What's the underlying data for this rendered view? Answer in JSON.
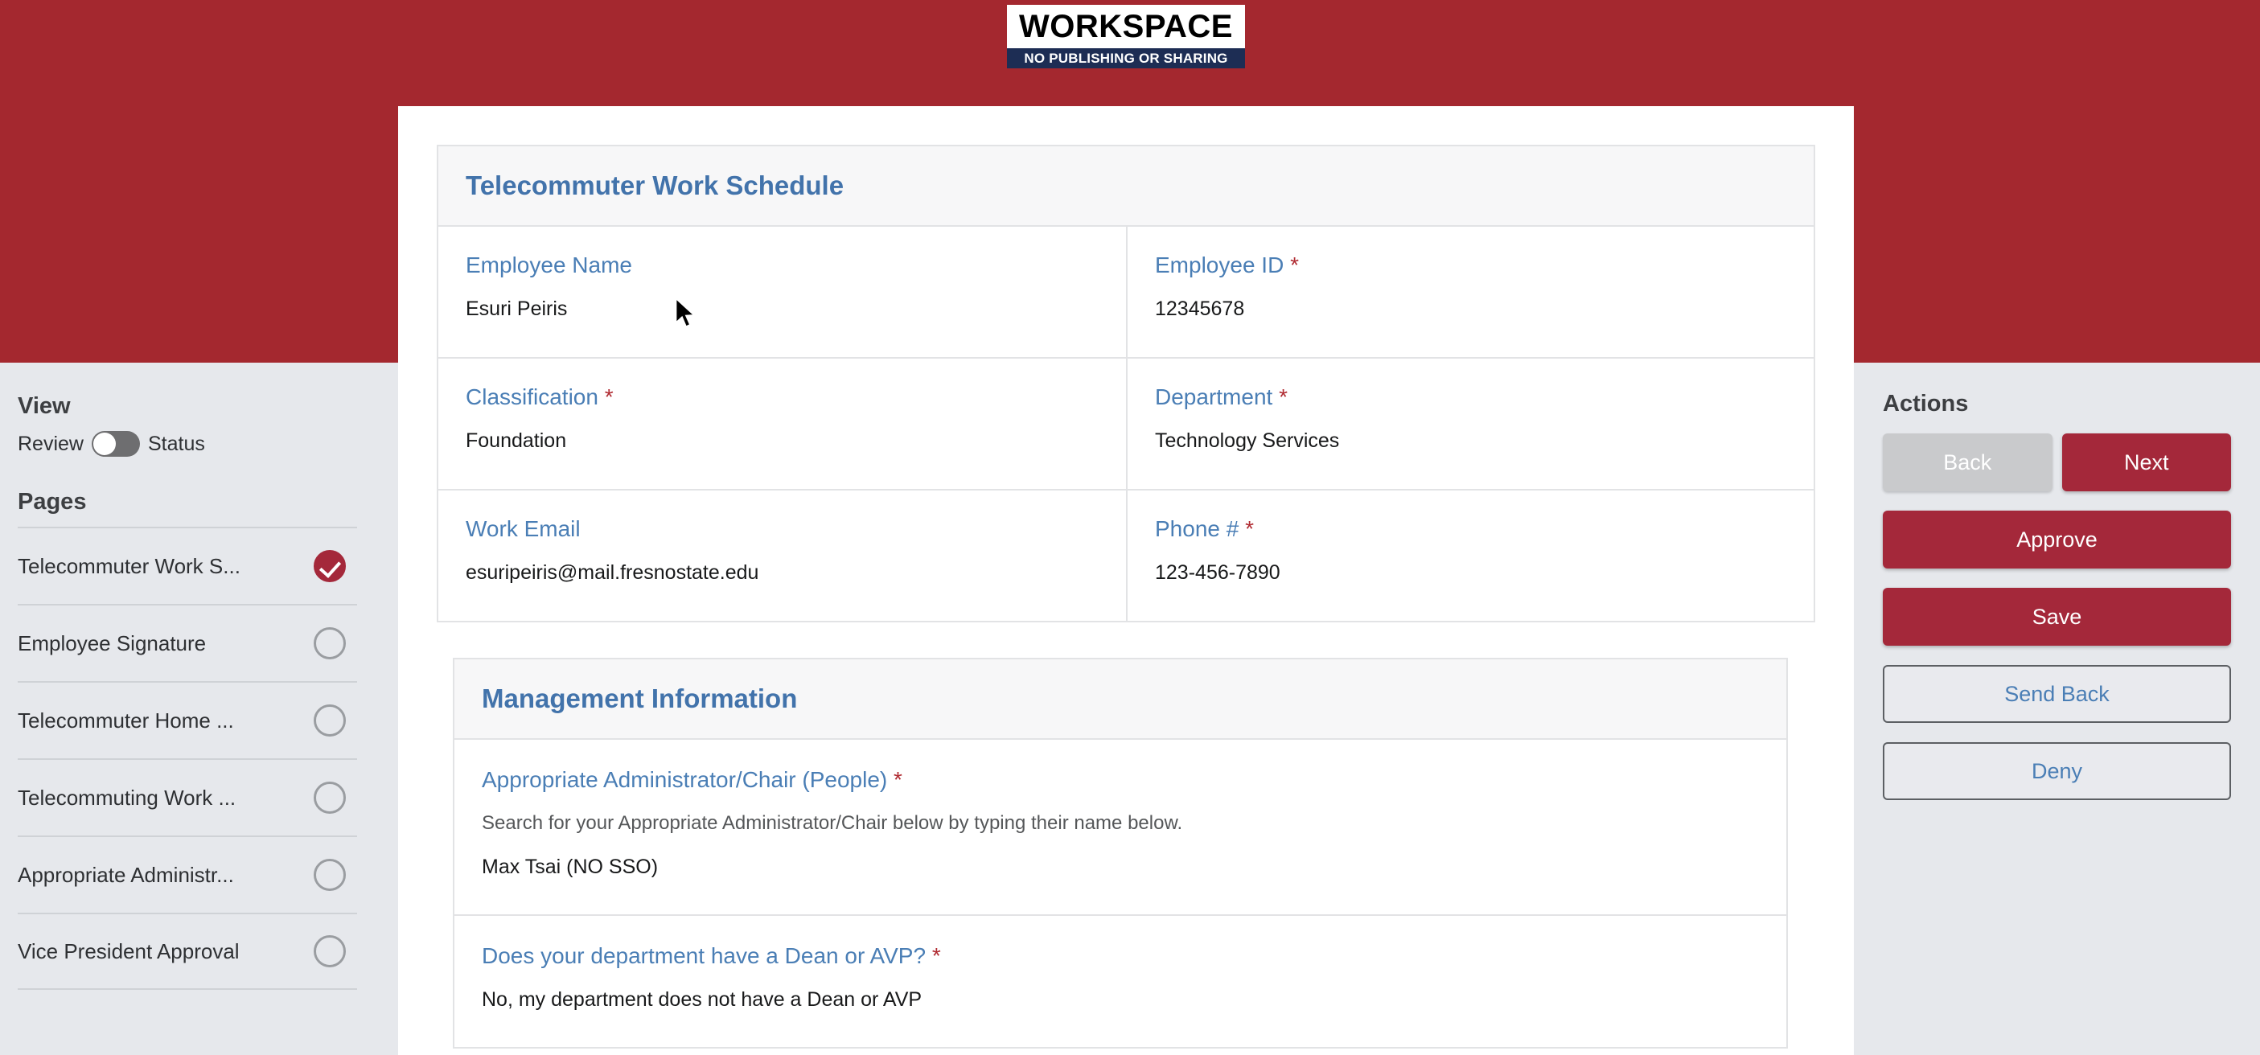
{
  "watermark": {
    "main": "WORKSPACE",
    "sub": "NO PUBLISHING OR SHARING"
  },
  "sidebar": {
    "view_heading": "View",
    "toggle_left_label": "Review",
    "toggle_right_label": "Status",
    "toggle_state": "Review",
    "pages_heading": "Pages",
    "pages": [
      {
        "label": "Telecommuter Work S...",
        "status": "complete"
      },
      {
        "label": "Employee Signature",
        "status": "incomplete"
      },
      {
        "label": "Telecommuter Home ...",
        "status": "incomplete"
      },
      {
        "label": "Telecommuting Work ...",
        "status": "incomplete"
      },
      {
        "label": "Appropriate Administr...",
        "status": "incomplete"
      },
      {
        "label": "Vice President Approval",
        "status": "incomplete"
      }
    ]
  },
  "form": {
    "title": "Telecommuter Work Schedule",
    "fields": {
      "employee_name_label": "Employee Name",
      "employee_name_value": "Esuri Peiris",
      "employee_id_label": "Employee ID",
      "employee_id_value": "12345678",
      "classification_label": "Classification",
      "classification_value": "Foundation",
      "department_label": "Department",
      "department_value": "Technology Services",
      "work_email_label": "Work Email",
      "work_email_value": "esuripeiris@mail.fresnostate.edu",
      "phone_label": "Phone #",
      "phone_value": "123-456-7890"
    },
    "required_marker": "*"
  },
  "management": {
    "title": "Management Information",
    "admin_label": "Appropriate Administrator/Chair (People)",
    "admin_help": "Search for your Appropriate Administrator/Chair below by typing their name below.",
    "admin_value": "Max Tsai (NO SSO)",
    "dean_label": "Does your department have a Dean or AVP?",
    "dean_value": "No, my department does not have a Dean or AVP"
  },
  "actions": {
    "heading": "Actions",
    "back": "Back",
    "next": "Next",
    "approve": "Approve",
    "save": "Save",
    "send_back": "Send Back",
    "deny": "Deny"
  },
  "colors": {
    "brand_crimson": "#a4283a",
    "banner_red": "#a4282f",
    "label_blue": "#4a7eb5",
    "title_blue": "#4273ab",
    "panel_gray": "#e6e8ec",
    "required_red": "#b02b32"
  }
}
